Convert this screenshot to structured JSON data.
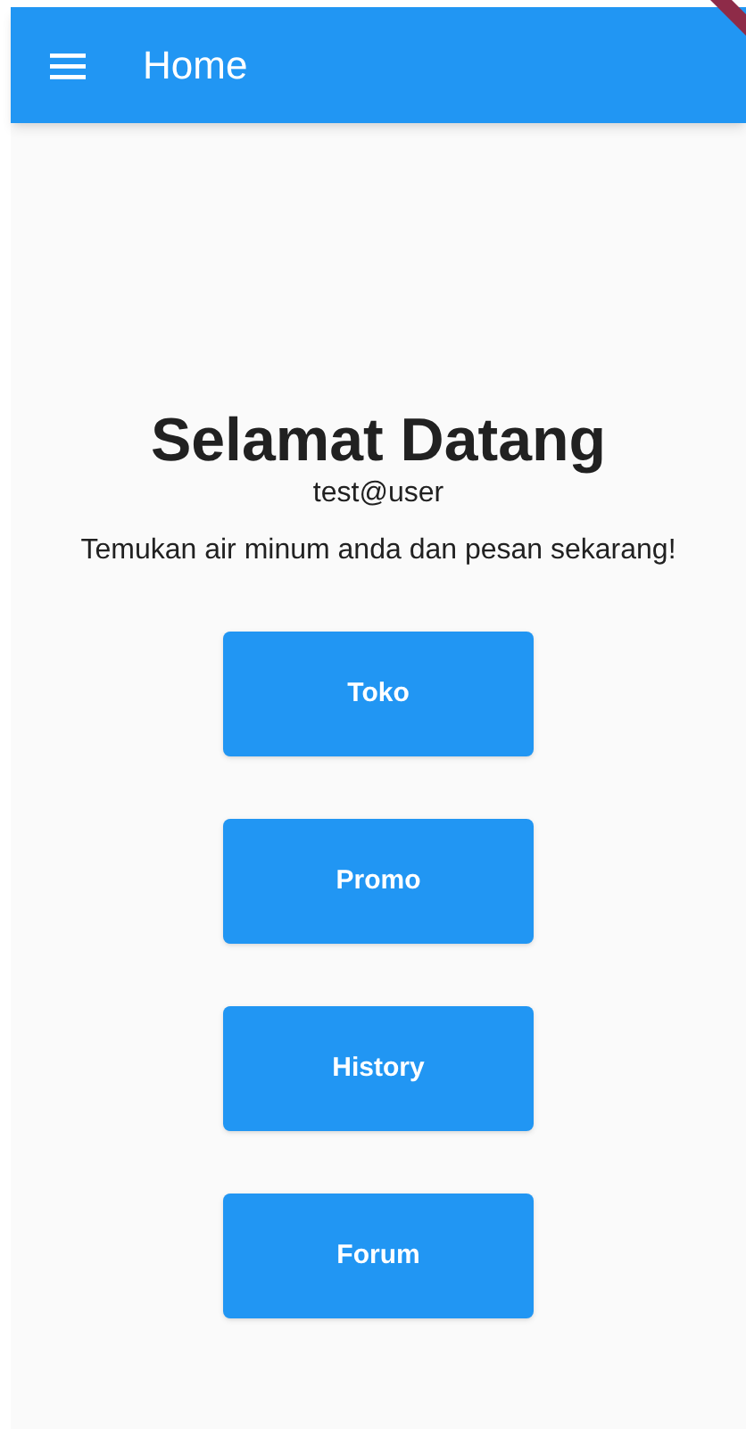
{
  "app_bar": {
    "title": "Home"
  },
  "welcome": {
    "heading": "Selamat Datang",
    "user": "test@user",
    "message": "Temukan air minum anda dan pesan sekarang!"
  },
  "buttons": [
    "Toko",
    "Promo",
    "History",
    "Forum"
  ]
}
